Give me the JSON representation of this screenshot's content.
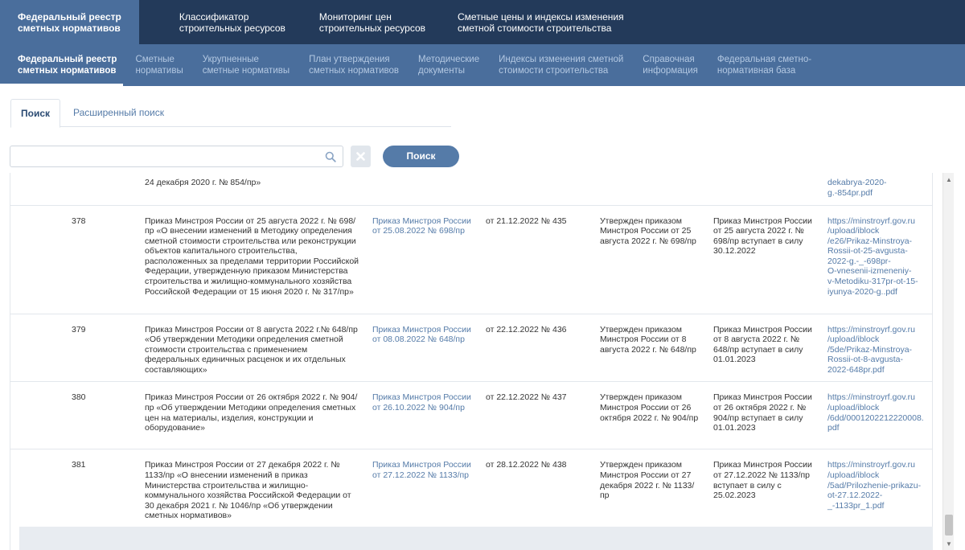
{
  "topnav": {
    "items": [
      {
        "line1": "Федеральный реестр",
        "line2": "сметных нормативов"
      },
      {
        "line1": "Классификатор",
        "line2": "строительных ресурсов"
      },
      {
        "line1": "Мониторинг цен",
        "line2": "строительных ресурсов"
      },
      {
        "line1": "Сметные цены и индексы изменения",
        "line2": "сметной стоимости строительства"
      }
    ]
  },
  "subnav": {
    "items": [
      {
        "line1": "Федеральный реестр",
        "line2": "сметных нормативов"
      },
      {
        "line1": "Сметные",
        "line2": "нормативы"
      },
      {
        "line1": "Укрупненные",
        "line2": "сметные нормативы"
      },
      {
        "line1": "План утверждения",
        "line2": "сметных нормативов"
      },
      {
        "line1": "Методические",
        "line2": "документы"
      },
      {
        "line1": "Индексы изменения сметной",
        "line2": "стоимости строительства"
      },
      {
        "line1": "Справочная",
        "line2": "информация"
      },
      {
        "line1": "Федеральная сметно-",
        "line2": "нормативная база"
      }
    ]
  },
  "tabs": {
    "search": "Поиск",
    "advanced": "Расширенный поиск"
  },
  "search": {
    "placeholder": "",
    "value": "",
    "button_label": "Поиск"
  },
  "table": {
    "partial_row": {
      "description": "24 декабря 2020 г. № 854/пр»",
      "link": "dekabrya-2020-\ng.-854pr.pdf"
    },
    "rows": [
      {
        "num": "378",
        "description": "Приказ Минстроя России от 25 августа 2022 г. № 698/пр «О внесении изменений в Методику определения сметной стоимости строительства или реконструкции объектов капитального строительства, расположенных за пределами территории Российской Федерации, утвержденную приказом Министерства строительства и жилищно-коммунального хозяйства Российской Федерации от 15 июня 2020 г. № 317/пр»",
        "order_link": "Приказ Минстроя России от 25.08.2022 № 698/пр",
        "registration": "от 21.12.2022 № 435",
        "approved": "Утвержден приказом Минстроя России от 25 августа 2022 г. № 698/пр",
        "effective": "Приказ Минстроя России от 25 августа 2022 г. № 698/пр вступает в силу 30.12.2022",
        "url": "https://minstroyrf.gov.ru\n/upload/iblock\n/e26/Prikaz-Minstroya-\nRossii-ot-25-avgusta-\n2022-g.-_-698pr-\nO-vnesenii-izmeneniy-\nv-Metodiku-317pr-ot-15-\niyunya-2020-g..pdf"
      },
      {
        "num": "379",
        "description": "Приказ Минстроя России от 8 августа 2022 г.№ 648/пр «Об утверждении Методики определения сметной стоимости строительства с применением федеральных единичных расценок и их отдельных составляющих»",
        "order_link": "Приказ Минстроя России от 08.08.2022 № 648/пр",
        "registration": "от 22.12.2022 № 436",
        "approved": "Утвержден приказом Минстроя России от 8 августа 2022 г. № 648/пр",
        "effective": "Приказ Минстроя России от 8 августа 2022 г. № 648/пр вступает в силу 01.01.2023",
        "url": "https://minstroyrf.gov.ru\n/upload/iblock\n/5de/Prikaz-Minstroya-\nRossii-ot-8-avgusta-\n2022-648pr.pdf"
      },
      {
        "num": "380",
        "description": "Приказ Минстроя России от 26 октября 2022 г. № 904/пр «Об утверждении Методики определения сметных цен на материалы, изделия, конструкции и оборудование»",
        "order_link": "Приказ Минстроя России от 26.10.2022 № 904/пр",
        "registration": "от 22.12.2022 № 437",
        "approved": "Утвержден приказом Минстроя России от 26 октября 2022 г. № 904/пр",
        "effective": "Приказ Минстроя России от 26 октября 2022 г. № 904/пр вступает в силу 01.01.2023",
        "url": "https://minstroyrf.gov.ru\n/upload/iblock\n/6dd/0001202212220008.\npdf"
      },
      {
        "num": "381",
        "description": "Приказ Минстроя России от 27 декабря 2022 г. № 1133/пр «О внесении изменений в приказ Министерства строительства и жилищно-коммунального хозяйства Российской Федерации от 30 декабря 2021 г. № 1046/пр «Об утверждении сметных нормативов»",
        "order_link": "Приказ Минстроя России от 27.12.2022 № 1133/пр",
        "registration": "от 28.12.2022 № 438",
        "approved": "Утвержден приказом Минстроя России от 27 декабря 2022 г. № 1133/пр",
        "effective": "Приказ Минстроя России от 27.12.2022 № 1133/пр вступает в силу с 25.02.2023",
        "url": "https://minstroyrf.gov.ru\n/upload/iblock\n/5ad/Prilozhenie-prikazu-\not-27.12.2022-\n_-1133pr_1.pdf"
      }
    ]
  },
  "colors": {
    "topnav_bg": "#233a5a",
    "subnav_bg": "#4a6e9c",
    "link": "#557ba8",
    "button": "#557ba8"
  }
}
